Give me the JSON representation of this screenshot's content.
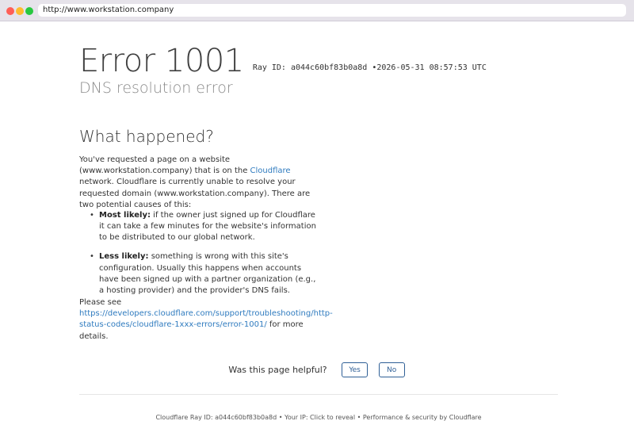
{
  "browser": {
    "url": "http://www.workstation.company"
  },
  "error": {
    "title": "Error 1001",
    "ray_id": "Ray ID: a044c60bf83b0a8d",
    "bullet": "•",
    "timestamp": "2026-05-31 08:57:53 UTC",
    "subtitle": "DNS resolution error"
  },
  "what_happened": {
    "heading": "What happened?",
    "para_pre": "You've requested a page on a website (www.workstation.company) that is on the ",
    "cloudflare_link": "Cloudflare",
    "para_post": " network. Cloudflare is currently unable to resolve your requested domain (www.workstation.company). There are two potential causes of this:",
    "causes": [
      {
        "label": "Most likely:",
        "text": " if the owner just signed up for Cloudflare it can take a few minutes for the website's information to be distributed to our global network."
      },
      {
        "label": "Less likely:",
        "text": " something is wrong with this site's configuration. Usually this happens when accounts have been signed up with a partner organization (e.g., a hosting provider) and the provider's DNS fails."
      }
    ],
    "see_pre": "Please see",
    "docs_link": "https://developers.cloudflare.com/support/troubleshooting/http-status-codes/cloudflare-1xxx-errors/error-1001/",
    "see_post": " for more details."
  },
  "feedback": {
    "question": "Was this page helpful?",
    "yes": "Yes",
    "no": "No"
  },
  "footer": {
    "text": "Cloudflare Ray ID: a044c60bf83b0a8d • Your IP: Click to reveal • Performance & security by Cloudflare"
  },
  "colors": {
    "link": "#2f7bbf",
    "button_border": "#2f5f96"
  }
}
